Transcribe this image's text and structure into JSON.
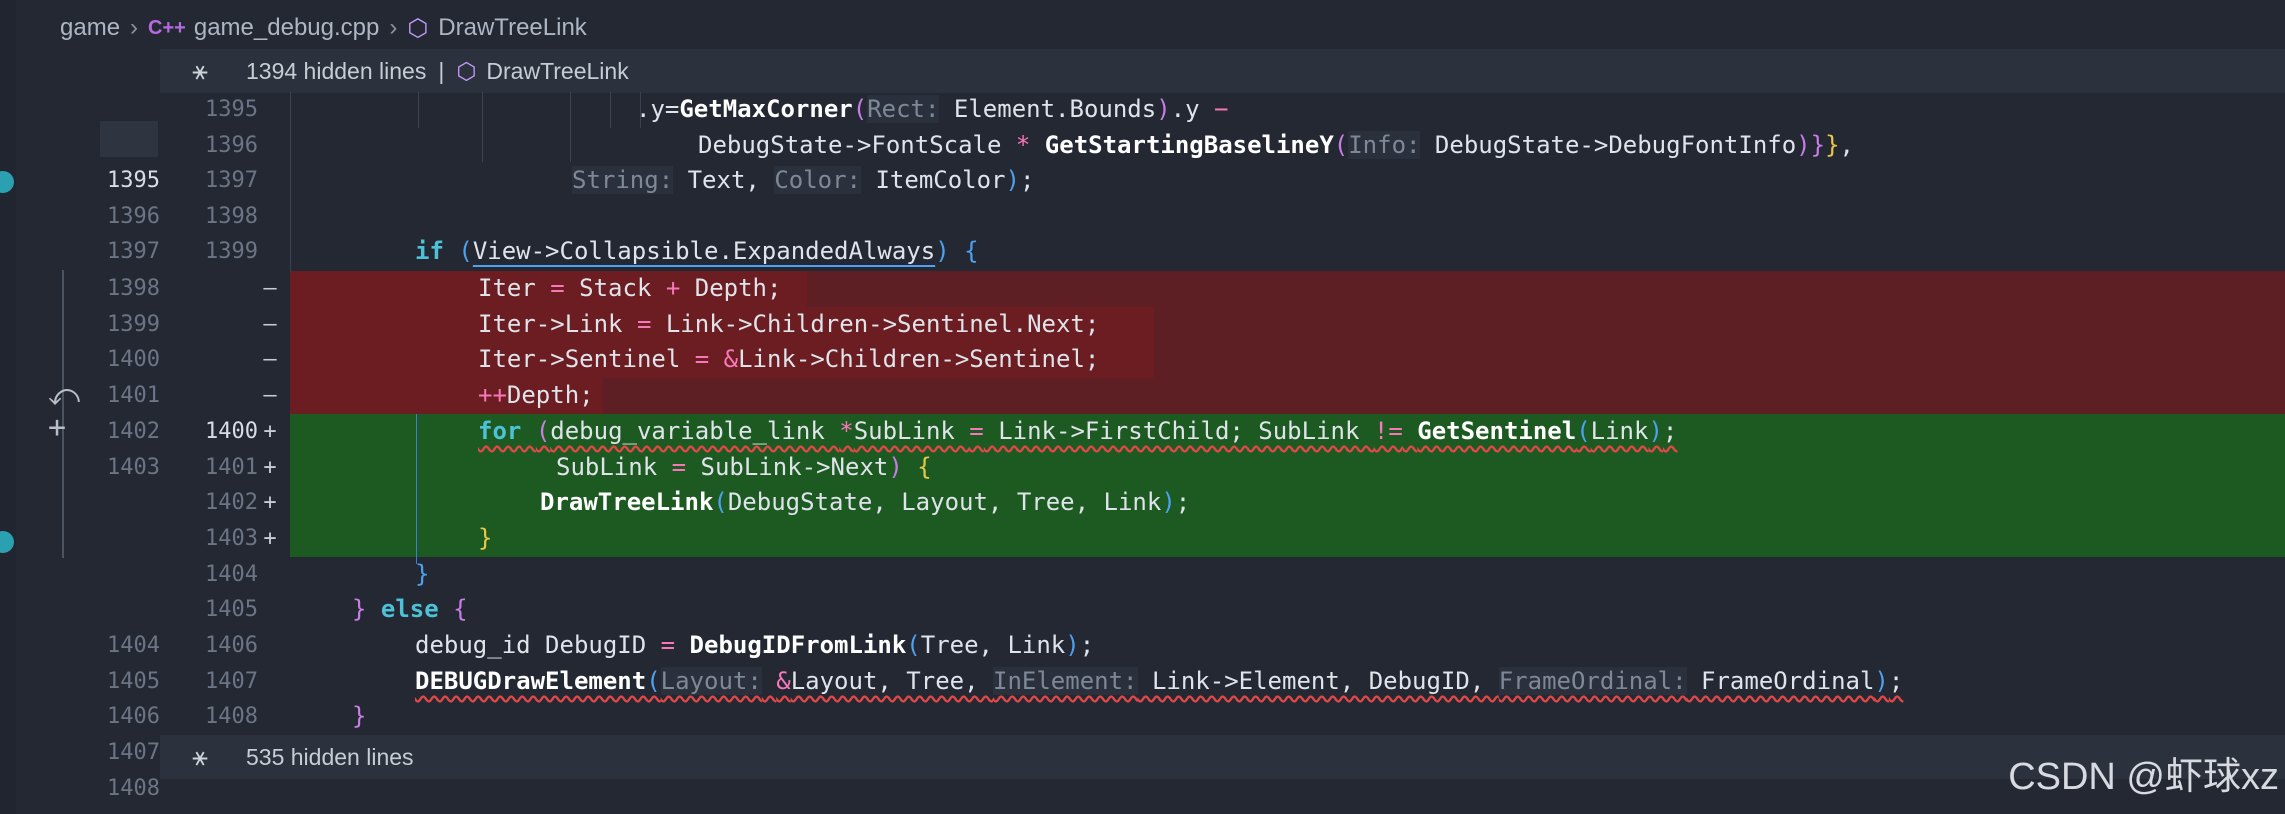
{
  "breadcrumb": {
    "folder": "game",
    "lang_glyph": "C++",
    "file": "game_debug.cpp",
    "symbol": "DrawTreeLink"
  },
  "hidden_top": {
    "count_text": "1394 hidden lines",
    "pipe": "|",
    "symbol": "DrawTreeLink"
  },
  "hidden_bottom": {
    "count_text": "535 hidden lines"
  },
  "watermark": "CSDN @虾球xz",
  "colors": {
    "removed_bg": "#5e1f24",
    "added_bg": "#1d5a22",
    "keyword": "#4fc1d6",
    "editor_bg": "#232833"
  },
  "rows": [
    {
      "left": "",
      "right": "1395"
    },
    {
      "left": "",
      "right": "1396"
    },
    {
      "left": "1395",
      "right": "1397"
    },
    {
      "left": "1396",
      "right": "1398"
    },
    {
      "left": "1397",
      "right": "1399"
    },
    {
      "left": "1398",
      "right": "",
      "mark": "—"
    },
    {
      "left": "1399",
      "right": "",
      "mark": "—"
    },
    {
      "left": "1400",
      "right": "",
      "mark": "—"
    },
    {
      "left": "1401",
      "right": "",
      "mark": "—"
    },
    {
      "left": "1402",
      "right": "1400",
      "mark": "+"
    },
    {
      "left": "1403",
      "right": "1401",
      "mark": "+"
    },
    {
      "left": "",
      "right": "1402",
      "mark": "+"
    },
    {
      "left": "",
      "right": "1403",
      "mark": "+"
    },
    {
      "left": "",
      "right": "1404"
    },
    {
      "left": "",
      "right": "1405"
    },
    {
      "left": "1404",
      "right": "1406"
    },
    {
      "left": "1405",
      "right": "1407"
    },
    {
      "left": "1406",
      "right": "1408"
    },
    {
      "left": "1407",
      "right": ""
    },
    {
      "left": "1408",
      "right": ""
    }
  ],
  "code": {
    "l1": {
      "a": ".y=",
      "fn": "GetMaxCorner",
      "p1": "(",
      "hint": "Rect:",
      "b": " Element.Bounds",
      "p2": ")",
      "c": ".y ",
      "op": "−"
    },
    "l2": {
      "a": "DebugState->FontScale ",
      "op": "*",
      "b": " ",
      "fn": "GetStartingBaselineY",
      "p1": "(",
      "hint": "Info:",
      "c": " DebugState->DebugFontInfo",
      "p2": ")",
      "p3": "}",
      "p4": "}",
      "d": ","
    },
    "l3": {
      "hint1": "String:",
      "a": " Text, ",
      "hint2": "Color:",
      "b": " ItemColor",
      "p": ")",
      "c": ";"
    },
    "l5": {
      "kw": "if",
      "a": " ",
      "p1": "(",
      "b": "View->Collapsible.ExpandedAlways",
      "p2": ")",
      "c": " ",
      "br": "{"
    },
    "d1": {
      "a": "Iter ",
      "op1": "=",
      "b": " Stack ",
      "op2": "+",
      "c": " Depth;"
    },
    "d2": {
      "a": "Iter->Link ",
      "op1": "=",
      "b": " Link->Children->Sentinel.Next;"
    },
    "d3": {
      "a": "Iter->Sentinel ",
      "op1": "=",
      "b": " ",
      "op2": "&",
      "c": "Link->Children->Sentinel;"
    },
    "d4": {
      "op": "++",
      "a": "Depth;"
    },
    "a1": {
      "kw": "for",
      "a": " ",
      "p1": "(",
      "b": "debug_variable_link ",
      "op1": "*",
      "c": "SubLink ",
      "op2": "=",
      "d": " Link->FirstChild; SubLink ",
      "op3": "!=",
      "e": " ",
      "fn": "GetSentinel",
      "p2": "(",
      "f": "Link",
      "p3": ")",
      "g": ";"
    },
    "a2": {
      "a": "SubLink ",
      "op": "=",
      "b": " SubLink->Next",
      "p": ")",
      "c": " ",
      "br": "{"
    },
    "a3": {
      "fn": "DrawTreeLink",
      "p1": "(",
      "a": "DebugState, Layout, Tree, Link",
      "p2": ")",
      "b": ";"
    },
    "a4": {
      "br": "}"
    },
    "l14": {
      "br": "}"
    },
    "l15": {
      "br1": "}",
      "kw": " else ",
      "br2": "{"
    },
    "l16": {
      "a": "debug_id DebugID ",
      "op": "=",
      "b": " ",
      "fn": "DebugIDFromLink",
      "p1": "(",
      "c": "Tree, Link",
      "p2": ")",
      "d": ";"
    },
    "l17": {
      "fn": "DEBUGDrawElement",
      "p1": "(",
      "hint1": "Layout:",
      "b": " ",
      "op": "&",
      "c": "Layout, Tree, ",
      "hint2": "InElement:",
      "d": " Link->Element, DebugID, ",
      "hint3": "FrameOrdinal:",
      "e": " FrameOrdinal",
      "p2": ")",
      "f": ";"
    },
    "l18": {
      "br": "}"
    }
  }
}
